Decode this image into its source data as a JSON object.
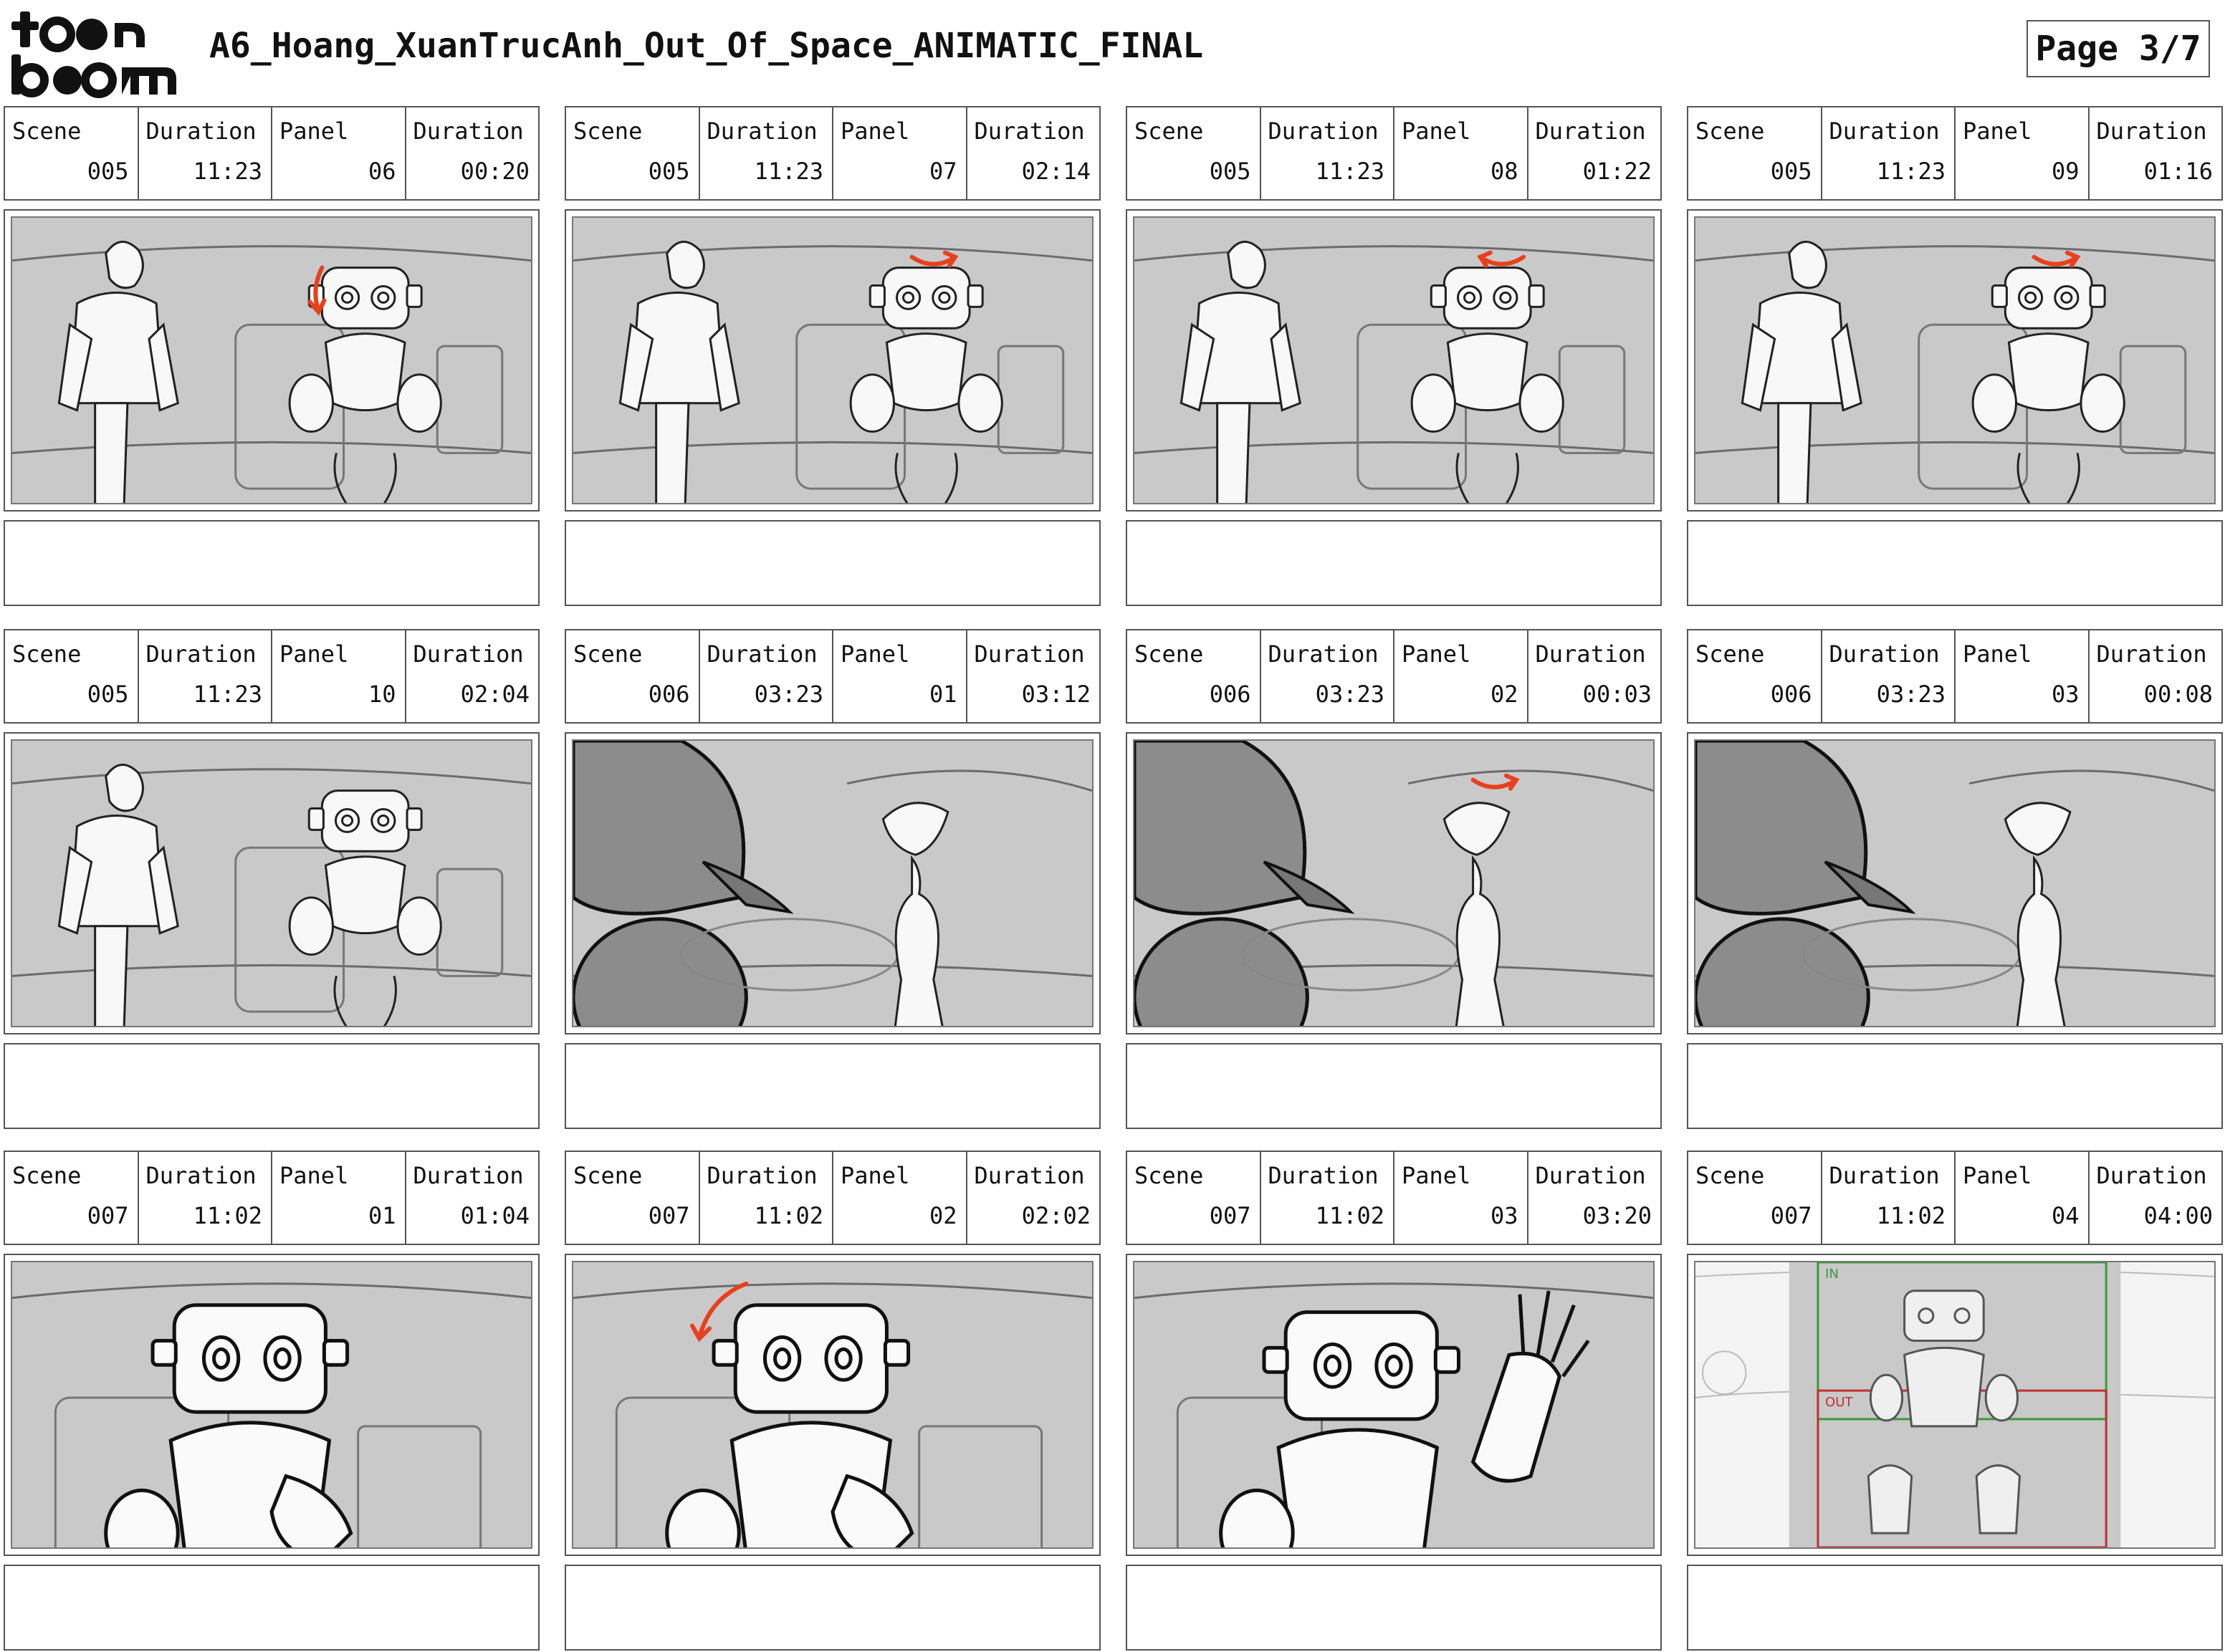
{
  "header": {
    "logo_top": "to●n",
    "logo_bottom": "b●●m",
    "title": "A6_Hoang_XuanTrucAnh_Out_Of_Space_ANIMATIC_FINAL",
    "page": "Page 3/7"
  },
  "labels": {
    "scene": "Scene",
    "duration": "Duration",
    "panel": "Panel"
  },
  "panels": [
    {
      "scene": "005",
      "scene_duration": "11:23",
      "panel": "06",
      "panel_duration": "00:20",
      "art": "man-robot",
      "arrow": "down"
    },
    {
      "scene": "005",
      "scene_duration": "11:23",
      "panel": "07",
      "panel_duration": "02:14",
      "art": "man-robot",
      "arrow": "right"
    },
    {
      "scene": "005",
      "scene_duration": "11:23",
      "panel": "08",
      "panel_duration": "01:22",
      "art": "man-robot",
      "arrow": "left"
    },
    {
      "scene": "005",
      "scene_duration": "11:23",
      "panel": "09",
      "panel_duration": "01:16",
      "art": "man-robot",
      "arrow": "right"
    },
    {
      "scene": "005",
      "scene_duration": "11:23",
      "panel": "10",
      "panel_duration": "02:04",
      "art": "man-robot",
      "arrow": "none"
    },
    {
      "scene": "006",
      "scene_duration": "03:23",
      "panel": "01",
      "panel_duration": "03:12",
      "art": "alien",
      "arrow": "none"
    },
    {
      "scene": "006",
      "scene_duration": "03:23",
      "panel": "02",
      "panel_duration": "00:03",
      "art": "alien",
      "arrow": "right"
    },
    {
      "scene": "006",
      "scene_duration": "03:23",
      "panel": "03",
      "panel_duration": "00:08",
      "art": "alien",
      "arrow": "none"
    },
    {
      "scene": "007",
      "scene_duration": "11:02",
      "panel": "01",
      "panel_duration": "01:04",
      "art": "robot-close",
      "arrow": "none"
    },
    {
      "scene": "007",
      "scene_duration": "11:02",
      "panel": "02",
      "panel_duration": "02:02",
      "art": "robot-close",
      "arrow": "curve-left"
    },
    {
      "scene": "007",
      "scene_duration": "11:02",
      "panel": "03",
      "panel_duration": "03:20",
      "art": "robot-wave",
      "arrow": "none"
    },
    {
      "scene": "007",
      "scene_duration": "11:02",
      "panel": "04",
      "panel_duration": "04:00",
      "art": "camera-move",
      "arrow": "none",
      "frame_in": "IN",
      "frame_out": "OUT"
    }
  ],
  "colors": {
    "arrow": "#e8401c",
    "panel_bg": "#c9c9c9",
    "frame_in": "#3a9a3a",
    "frame_out": "#c03030"
  }
}
